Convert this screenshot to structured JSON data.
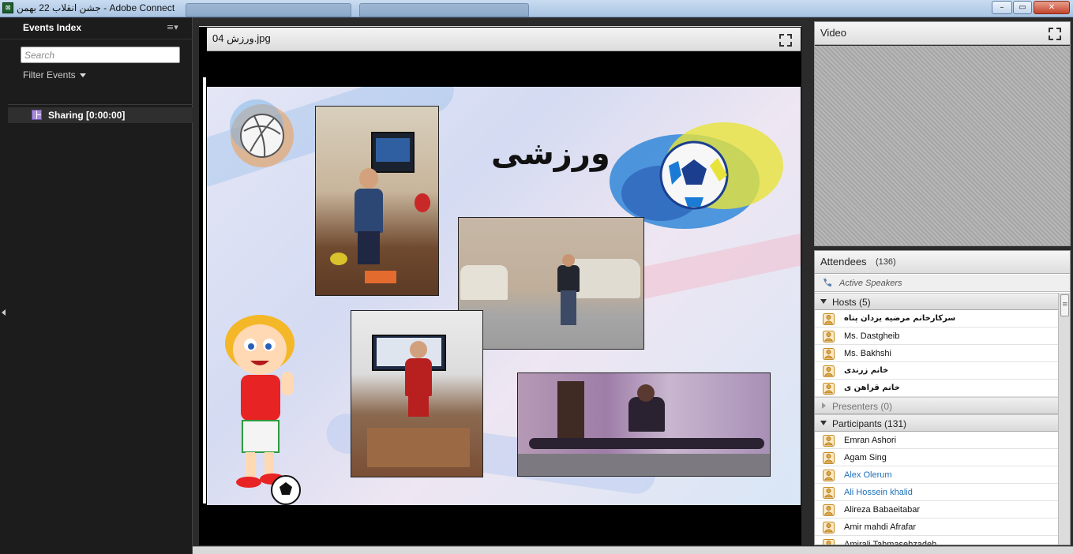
{
  "window": {
    "title": "جشن انقلاب 22 بهمن - Adobe Connect",
    "icon_glyph": "⊠",
    "min_glyph": "–",
    "max_glyph": "▭",
    "close_glyph": "✕"
  },
  "events_panel": {
    "title": "Events Index",
    "menu_glyph": "≡▾",
    "search_placeholder": "Search",
    "filter_label": "Filter Events",
    "events": [
      {
        "label": "Sharing [0:00:00]"
      }
    ]
  },
  "share_pod": {
    "file_name": "04 ورزش.jpg",
    "slide_heading": "ورزشی"
  },
  "video_pod": {
    "title": "Video"
  },
  "attendees": {
    "title": "Attendees",
    "count": "(136)",
    "active_speakers_label": "Active Speakers",
    "groups": [
      {
        "label": "Hosts (5)",
        "expanded": true,
        "members": [
          {
            "name": "سرکارخانم مرضیه یزدان پناه",
            "rtl": true,
            "color": "#111111"
          },
          {
            "name": "Ms.  Dastgheib",
            "rtl": false,
            "color": "#111111"
          },
          {
            "name": " Ms. Bakhshi",
            "rtl": false,
            "color": "#111111"
          },
          {
            "name": "خانم  زرندی",
            "rtl": true,
            "color": "#111111"
          },
          {
            "name": "خانم قراهن ی",
            "rtl": true,
            "color": "#111111"
          }
        ]
      },
      {
        "label": "Presenters (0)",
        "expanded": false,
        "members": []
      },
      {
        "label": "Participants (131)",
        "expanded": true,
        "members": [
          {
            "name": "Emran  Ashori",
            "rtl": false,
            "color": "#111111"
          },
          {
            "name": "Agam Sing",
            "rtl": false,
            "color": "#111111"
          },
          {
            "name": "Alex Olerum",
            "rtl": false,
            "color": "#1d6fb8"
          },
          {
            "name": "Ali Hossein khalid",
            "rtl": false,
            "color": "#1d6fb8"
          },
          {
            "name": "Alireza Babaeitabar",
            "rtl": false,
            "color": "#111111"
          },
          {
            "name": "Amir mahdi Afrafar",
            "rtl": false,
            "color": "#111111"
          },
          {
            "name": "Amirali Tahmasebzadeh",
            "rtl": false,
            "color": "#111111"
          }
        ]
      }
    ]
  },
  "colors": {
    "host_icon": "#e0a83c",
    "link_blue": "#1d6fb8"
  }
}
